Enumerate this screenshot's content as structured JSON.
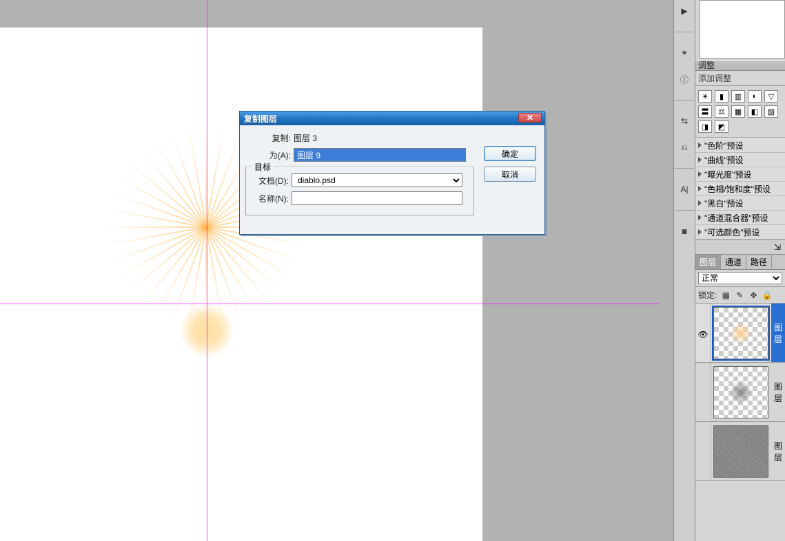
{
  "dialog": {
    "title": "复制图层",
    "duplicate_label": "复制:",
    "duplicate_value": "图层 3",
    "as_label": "为(A):",
    "as_value": "图层 9",
    "target_legend": "目标",
    "doc_label": "文档(D):",
    "doc_value": "diablo.psd",
    "name_label": "名称(N):",
    "name_value": "",
    "ok": "确定",
    "cancel": "取消",
    "close_glyph": "✕"
  },
  "panels": {
    "adjust_title": "调整",
    "adjust_sub": "添加调整",
    "presets": [
      "\"色阶\"预设",
      "\"曲线\"预设",
      "\"曝光度\"预设",
      "\"色相/饱和度\"预设",
      "\"黑白\"预设",
      "\"通道混合器\"预设",
      "\"可选颜色\"预设"
    ],
    "tabs": {
      "layers": "图层",
      "channels": "通道",
      "paths": "路径"
    },
    "blend_mode": "正常",
    "lock_label": "锁定:",
    "layers": [
      {
        "name": "图层",
        "visible": true,
        "thumb": "burst",
        "active": true
      },
      {
        "name": "图层",
        "visible": false,
        "thumb": "gray",
        "active": false
      },
      {
        "name": "图层",
        "visible": false,
        "thumb": "noise",
        "active": false
      }
    ]
  },
  "icons": {
    "adjust_row1": [
      "☀",
      "▮",
      "▥",
      "◐"
    ],
    "adjust_row2": [
      "▽",
      "〓",
      "⚖",
      "▦"
    ],
    "adjust_row3": [
      "◧",
      "▨",
      "◨",
      "◩"
    ]
  }
}
